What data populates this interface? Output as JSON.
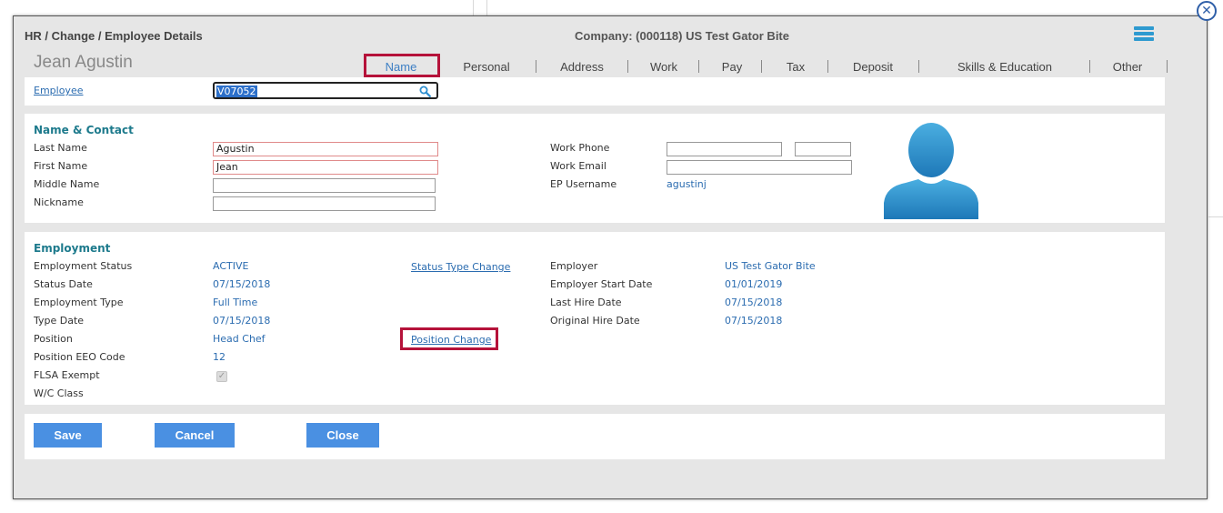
{
  "window": {
    "breadcrumb": "HR / Change / Employee Details",
    "company": "Company: (000118) US Test Gator Bite",
    "employee_name": "Jean Agustin",
    "close_icon": "close-icon",
    "menu_icon": "list-menu-icon"
  },
  "tabs": [
    {
      "label": "Name",
      "active": true
    },
    {
      "label": "Personal"
    },
    {
      "label": "Address"
    },
    {
      "label": "Work"
    },
    {
      "label": "Pay"
    },
    {
      "label": "Tax"
    },
    {
      "label": "Deposit"
    },
    {
      "label": "Skills & Education"
    },
    {
      "label": "Other"
    }
  ],
  "employee_lookup": {
    "label": "Employee",
    "value": "V07052",
    "icon": "search-icon"
  },
  "name_contact": {
    "title": "Name & Contact",
    "last_name_label": "Last Name",
    "last_name": "Agustin",
    "first_name_label": "First Name",
    "first_name": "Jean",
    "middle_name_label": "Middle Name",
    "middle_name": "",
    "nickname_label": "Nickname",
    "nickname": "",
    "work_phone_label": "Work Phone",
    "work_phone": "",
    "work_phone_ext": "",
    "work_email_label": "Work Email",
    "work_email": "",
    "ep_username_label": "EP Username",
    "ep_username": "agustinj"
  },
  "employment": {
    "title": "Employment",
    "employment_status_label": "Employment Status",
    "employment_status": "ACTIVE",
    "status_date_label": "Status Date",
    "status_date": "07/15/2018",
    "employment_type_label": "Employment Type",
    "employment_type": "Full Time",
    "type_date_label": "Type Date",
    "type_date": "07/15/2018",
    "position_label": "Position",
    "position": "Head Chef",
    "position_eeo_label": "Position EEO Code",
    "position_eeo": "12",
    "flsa_label": "FLSA Exempt",
    "flsa_checked": true,
    "wc_class_label": "W/C Class",
    "status_type_change_link": "Status Type Change",
    "position_change_link": "Position Change",
    "employer_label": "Employer",
    "employer": "US Test Gator Bite",
    "employer_start_label": "Employer Start Date",
    "employer_start": "01/01/2019",
    "last_hire_label": "Last Hire Date",
    "last_hire": "07/15/2018",
    "original_hire_label": "Original Hire Date",
    "original_hire": "07/15/2018"
  },
  "actions": {
    "save": "Save",
    "cancel": "Cancel",
    "close": "Close"
  },
  "colors": {
    "accent": "#4a90e2",
    "link": "#2b6cb0",
    "section_title": "#1d7a8c",
    "highlight": "#b5123a"
  }
}
